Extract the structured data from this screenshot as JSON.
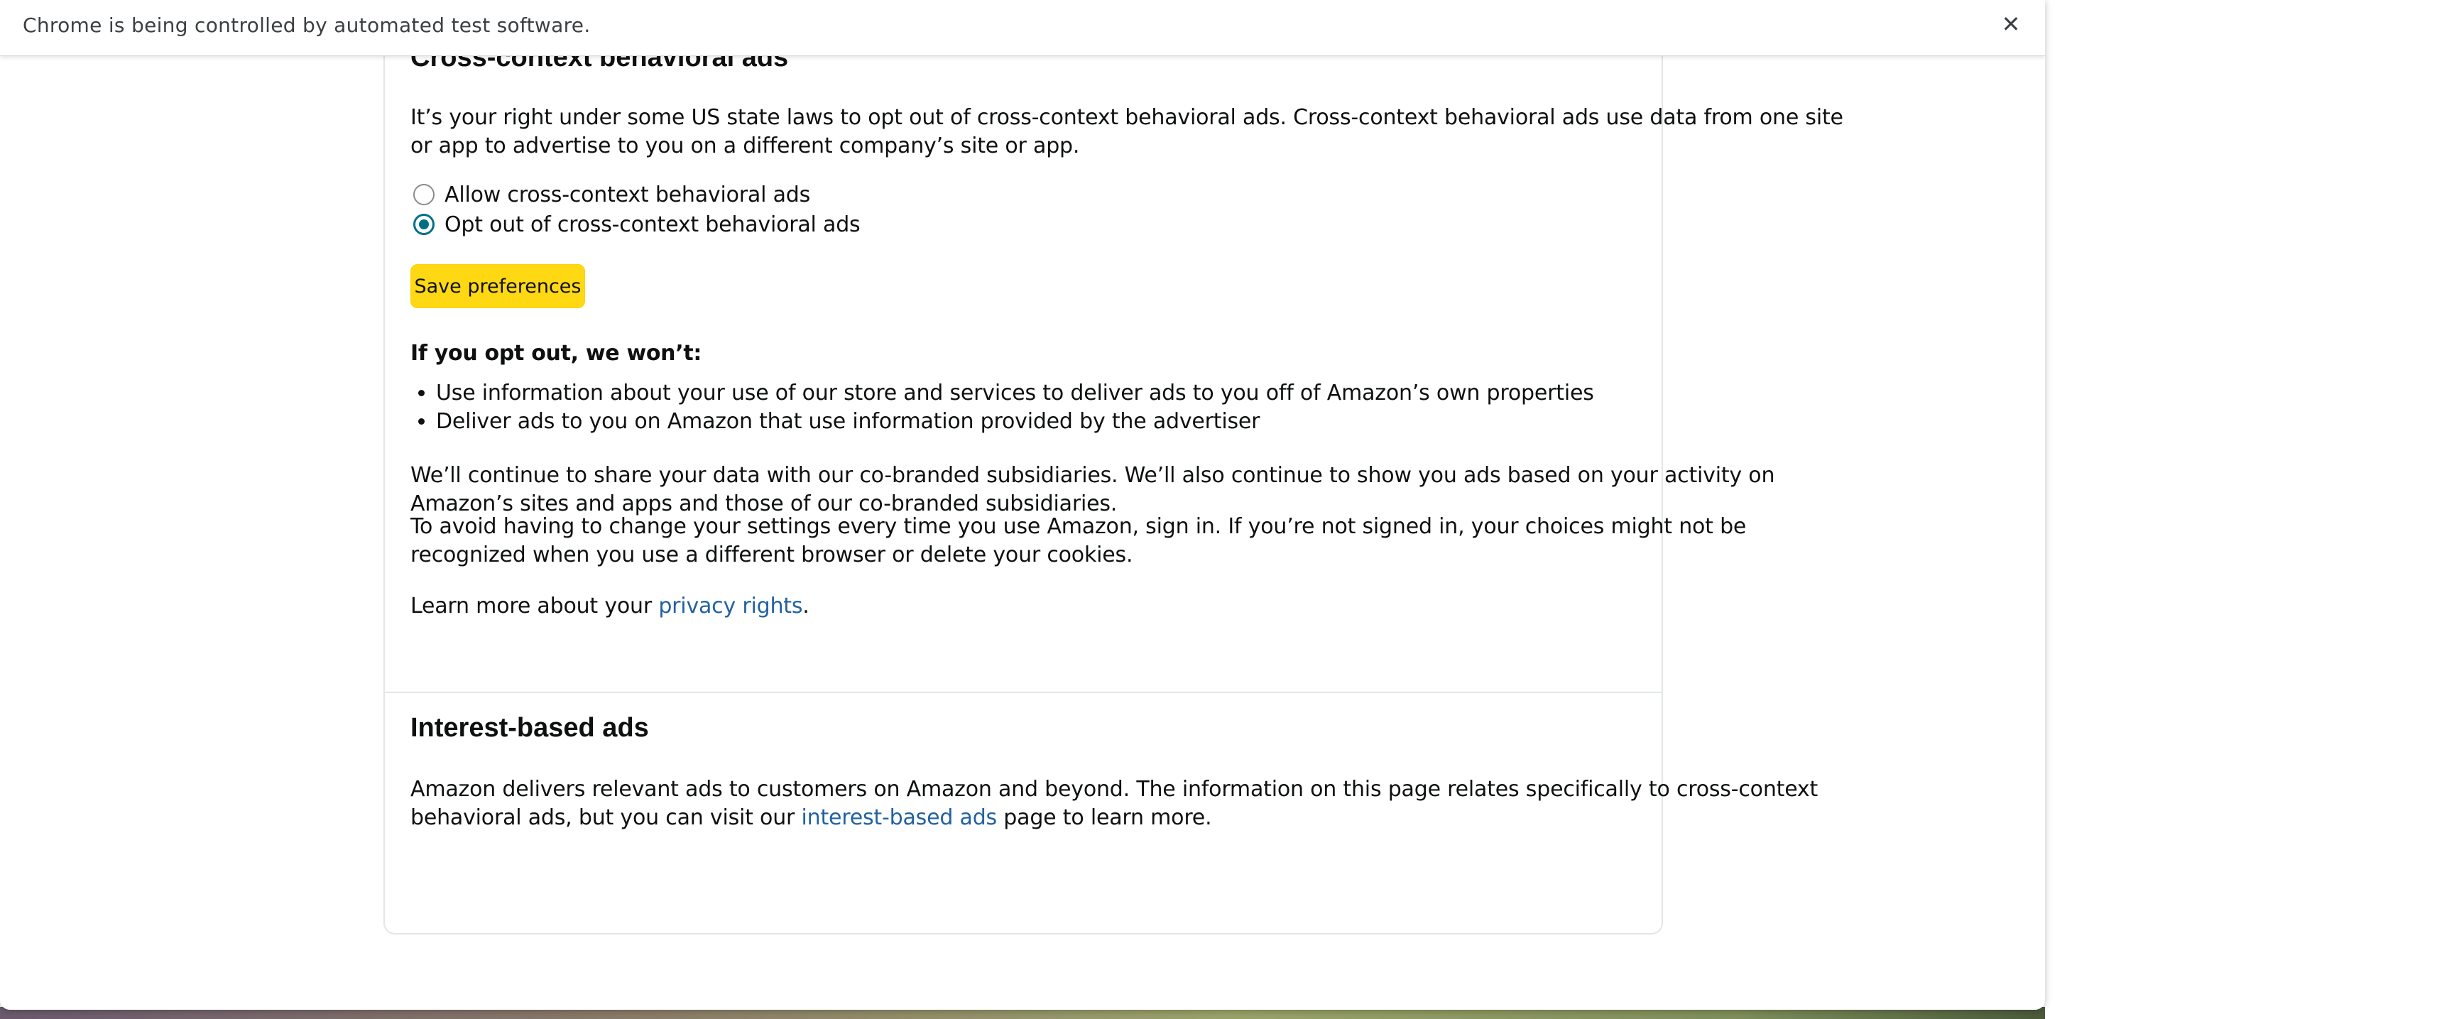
{
  "infobar": {
    "message": "Chrome is being controlled by automated test software.",
    "close_icon": "close-icon",
    "close_glyph": "✕"
  },
  "cross_context": {
    "heading": "Cross-context behavioral ads",
    "intro_line1": "It’s your right under some US state laws to opt out of cross-context behavioral ads. Cross-context behavioral ads use data from one site",
    "intro_line2": "or app to advertise to you on a different company’s site or app.",
    "options": [
      {
        "label": "Allow cross-context behavioral ads",
        "checked": false
      },
      {
        "label": "Opt out of cross-context behavioral ads",
        "checked": true
      }
    ],
    "save_label": "Save preferences",
    "wont_heading": "If you opt out, we won’t:",
    "wont_items": [
      "Use information about your use of our store and services to deliver ads to you off of Amazon’s own properties",
      "Deliver ads to you on Amazon that use information provided by the advertiser"
    ],
    "continue_line1": "We’ll continue to share your data with our co-branded subsidiaries. We’ll also continue to show you ads based on your activity on",
    "continue_line2": "Amazon’s sites and apps and those of our co-branded subsidiaries.",
    "avoid_line1": "To avoid having to change your settings every time you use Amazon, sign in. If you’re not signed in, your choices might not be",
    "avoid_line2": "recognized when you use a different browser or delete your cookies.",
    "learn_prefix": "Learn more about your ",
    "learn_link": "privacy rights",
    "learn_suffix": "."
  },
  "interest_based": {
    "heading": "Interest-based ads",
    "line1": "Amazon delivers relevant ads to customers on Amazon and beyond. The information on this page relates specifically to cross-context",
    "line2_prefix": "behavioral ads, but you can visit our ",
    "line2_link": "interest-based ads",
    "line2_suffix": " page to learn more."
  },
  "colors": {
    "accent_button": "#FFD814",
    "link": "#2162a1",
    "radio_selected": "#007185"
  }
}
